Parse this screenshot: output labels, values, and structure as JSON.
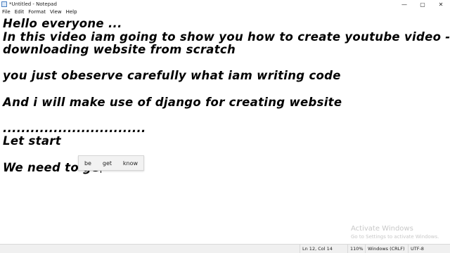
{
  "window": {
    "title": "*Untitled - Notepad",
    "icon": "notepad-icon",
    "controls": {
      "minimize": "—",
      "maximize": "▢",
      "close": "✕"
    }
  },
  "menu": {
    "items": [
      "File",
      "Edit",
      "Format",
      "View",
      "Help"
    ]
  },
  "editor": {
    "lines": [
      "Hello everyone ...",
      "In this video iam going to show you how to create youtube video -",
      "downloading website from scratch",
      "",
      "you just obeserve carefully what iam writing code",
      "",
      "And i will make use of django for creating website",
      "",
      "...............................",
      "Let start",
      "",
      "We need to ge"
    ]
  },
  "autocomplete": {
    "suggestions": [
      "be",
      "get",
      "know"
    ]
  },
  "watermark": {
    "title": "Activate Windows",
    "subtitle": "Go to Settings to activate Windows."
  },
  "status": {
    "position": "Ln 12, Col 14",
    "zoom": "110%",
    "line_ending": "Windows (CRLF)",
    "encoding": "UTF-8"
  }
}
